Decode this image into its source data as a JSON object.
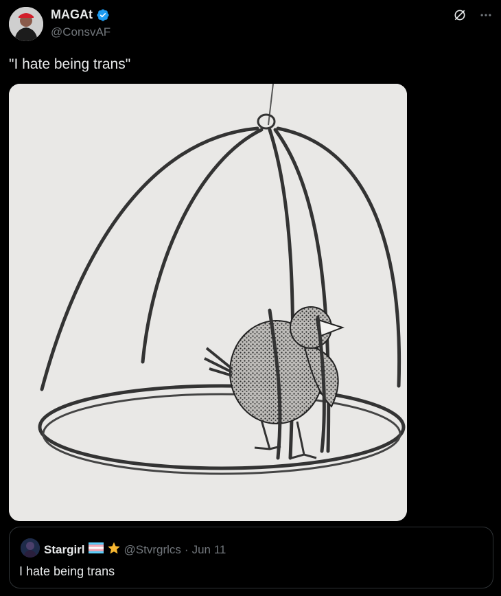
{
  "post": {
    "author_name": "MAGAt",
    "author_handle": "@ConsvAF",
    "text": "\"I hate being trans\""
  },
  "icons": {
    "verified": "verified-badge-icon",
    "grok": "grok-icon",
    "more": "more-icon",
    "flag": "trans-flag-icon",
    "star": "star-icon"
  },
  "quote": {
    "author_name": "Stargirl",
    "author_handle": "@Stvrgrlcs",
    "separator": "·",
    "date": "Jun 11",
    "text": "I hate being trans"
  },
  "colors": {
    "background": "#000000",
    "text": "#e7e9ea",
    "muted": "#71767b",
    "accent": "#1d9bf0",
    "border": "#2f3336"
  }
}
